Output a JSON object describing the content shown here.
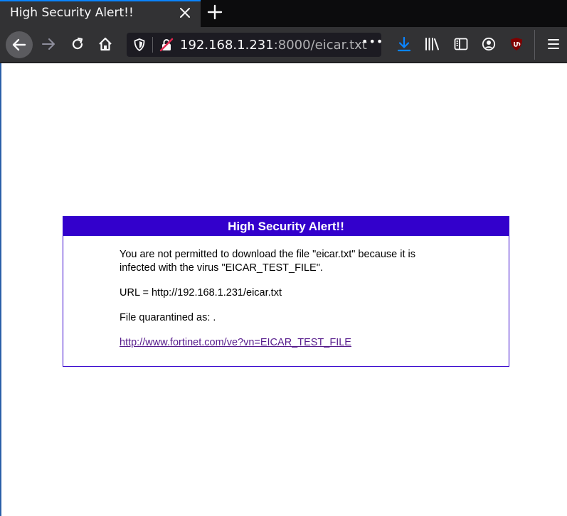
{
  "browser": {
    "tab": {
      "title": "High Security Alert!!"
    },
    "toolbar": {
      "url_host": "192.168.1.231",
      "url_rest": ":8000/eicar.txt",
      "page_actions_label": "•••"
    },
    "accent_color": "#0a84ff"
  },
  "alert": {
    "title": "High Security Alert!!",
    "message": "You are not permitted to download the file \"eicar.txt\" because it is infected with the virus \"EICAR_TEST_FILE\".",
    "url_line": "URL = http://192.168.1.231/eicar.txt",
    "quarantine_line": "File quarantined as: .",
    "info_link": "http://www.fortinet.com/ve?vn=EICAR_TEST_FILE",
    "header_color": "#3300cc"
  }
}
